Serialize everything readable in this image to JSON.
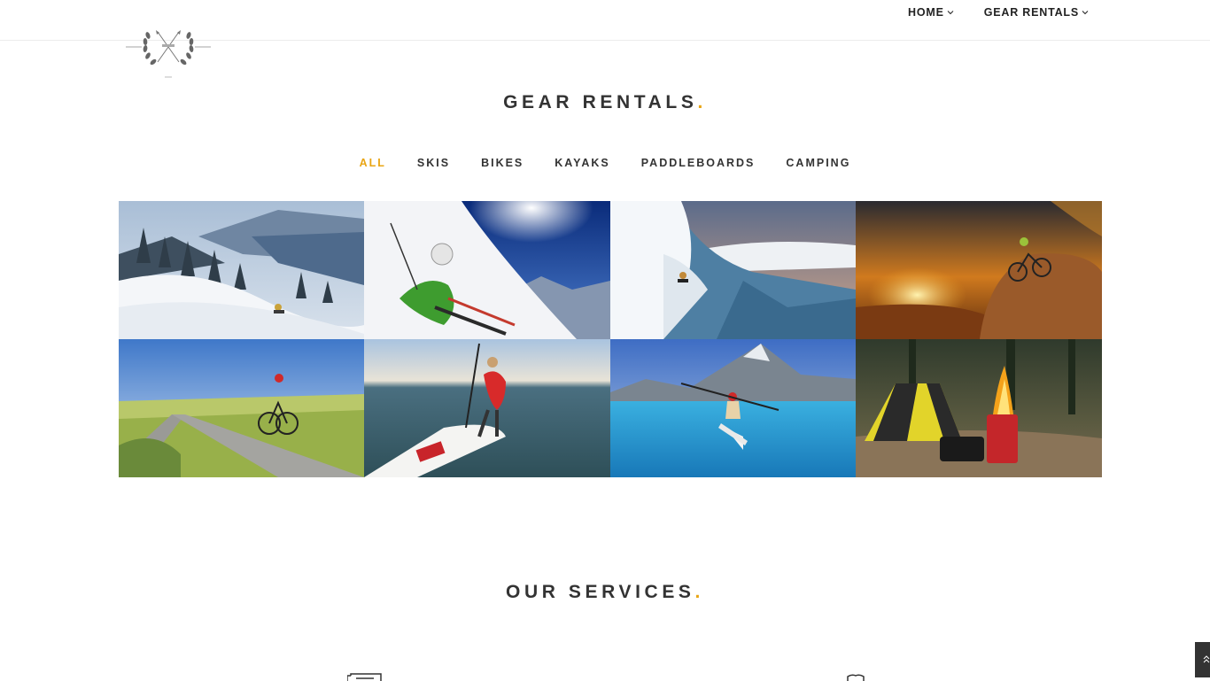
{
  "nav": {
    "items": [
      {
        "label": "HOME"
      },
      {
        "label": "GEAR RENTALS"
      }
    ]
  },
  "gear": {
    "title": "GEAR RENTALS",
    "title_dot": "."
  },
  "filters": [
    {
      "label": "ALL",
      "active": true
    },
    {
      "label": "SKIS",
      "active": false
    },
    {
      "label": "BIKES",
      "active": false
    },
    {
      "label": "KAYAKS",
      "active": false
    },
    {
      "label": "PADDLEBOARDS",
      "active": false
    },
    {
      "label": "CAMPING",
      "active": false
    }
  ],
  "gallery": [
    {
      "subject": "skier in snowy forest by lake"
    },
    {
      "subject": "skier in green jacket on slope"
    },
    {
      "subject": "skier on steep mountain face"
    },
    {
      "subject": "mountain biker at sunset"
    },
    {
      "subject": "road cyclist in meadow"
    },
    {
      "subject": "stand-up paddleboarder"
    },
    {
      "subject": "kayaker on glacial lake"
    },
    {
      "subject": "tent and campfire stove"
    }
  ],
  "services": {
    "title": "OUR SERVICES",
    "title_dot": "."
  },
  "colors": {
    "accent": "#e9a514",
    "text": "#333333",
    "to_top_bg": "#333333"
  },
  "icons": [
    "chevron-down-icon",
    "laurel-logo",
    "arrow-up-icon",
    "document-icon",
    "shield-icon"
  ]
}
